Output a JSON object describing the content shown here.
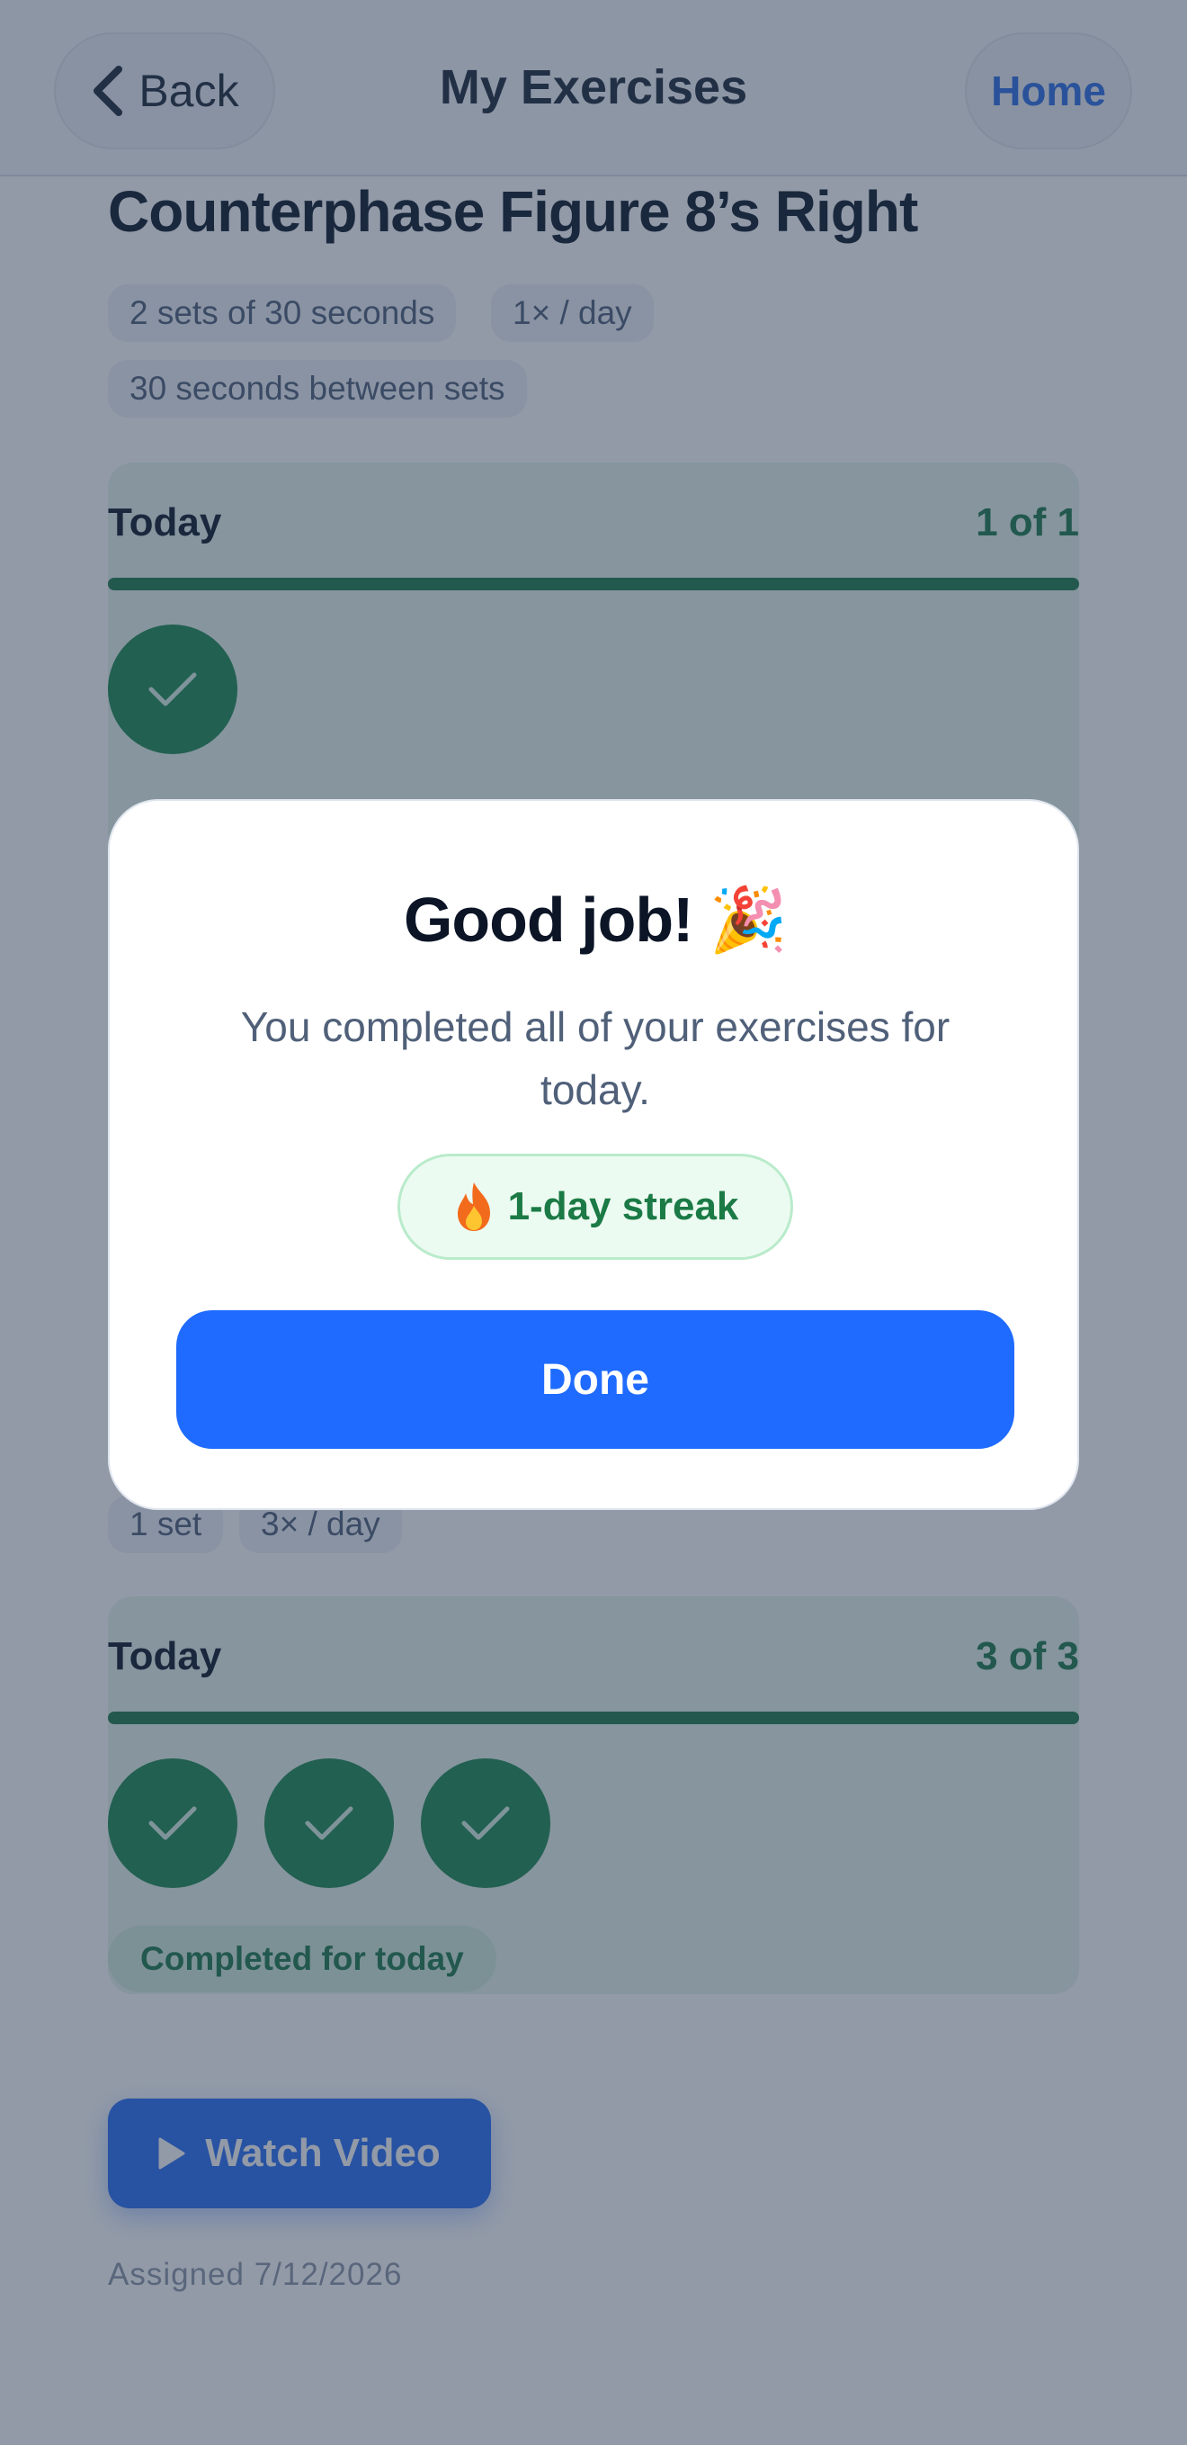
{
  "header": {
    "back_label": "Back",
    "title": "My Exercises",
    "home_label": "Home"
  },
  "exercise": {
    "title": "Counterphase Figure 8’s Right",
    "chips": [
      "2 sets of 30 seconds",
      "1× / day",
      "30 seconds between sets"
    ],
    "today": {
      "label": "Today",
      "count": "1 of 1",
      "progress": 1.0,
      "completed_sets": 1
    }
  },
  "exercise2": {
    "chips": [
      "1 set",
      "3× / day"
    ],
    "today": {
      "label": "Today",
      "count": "3 of 3",
      "progress": 1.0,
      "completed_sets": 3
    },
    "completed_label": "Completed for today"
  },
  "footer": {
    "watch_video_label": "Watch Video",
    "assigned": "Assigned 7/12/2026"
  },
  "modal": {
    "title": "Good job! 🎉",
    "message": "You completed all of your exercises for today.",
    "streak_label": "1-day streak",
    "done_label": "Done"
  },
  "colors": {
    "accent_blue": "#1f6bff",
    "success_green": "#1f8a52",
    "streak_green": "#1b7a45"
  },
  "icons": {
    "back": "chevron-left-icon",
    "check": "checkmark-icon",
    "play": "play-icon",
    "streak": "fire-icon"
  }
}
